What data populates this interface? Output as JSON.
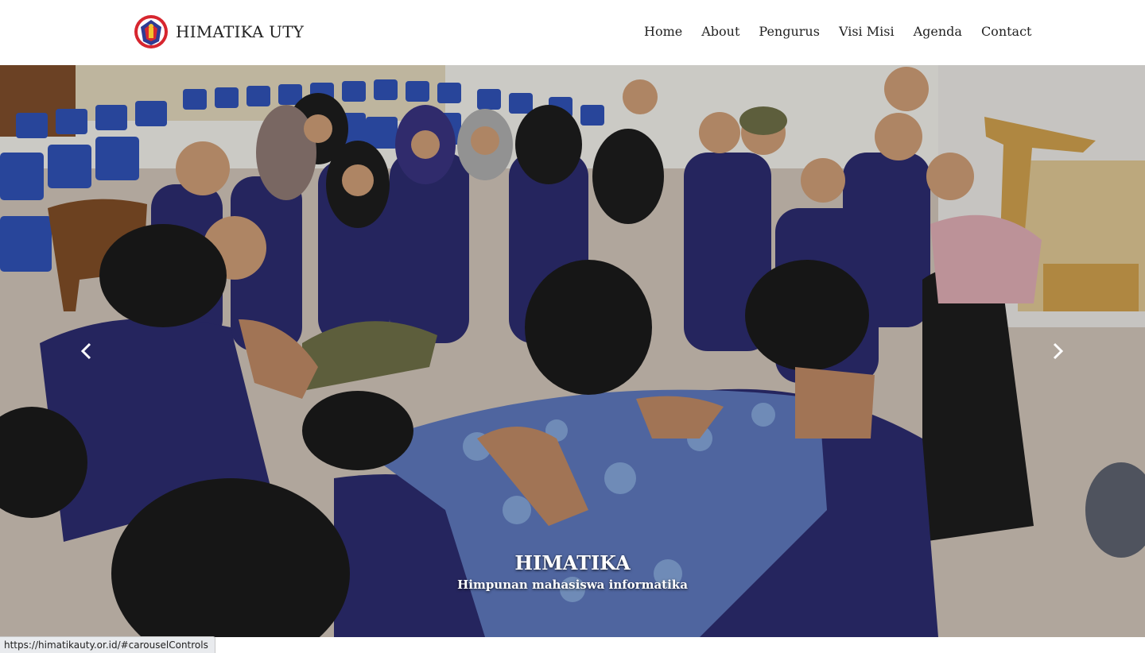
{
  "brand": {
    "name": "HIMATIKA UTY",
    "logo_icon": "himatika-emblem-icon"
  },
  "nav": {
    "items": [
      {
        "label": "Home"
      },
      {
        "label": "About"
      },
      {
        "label": "Pengurus"
      },
      {
        "label": "Visi Misi"
      },
      {
        "label": "Agenda"
      },
      {
        "label": "Contact"
      }
    ]
  },
  "carousel": {
    "caption_title": "HIMATIKA",
    "caption_subtitle": "Himpunan mahasiswa informatika",
    "prev_icon": "chevron-left-icon",
    "next_icon": "chevron-right-icon"
  },
  "status_url": "https://himatikauty.or.id/#carouselControls",
  "colors": {
    "navy": "#2b2b6b",
    "room_floor": "#c9bdb2",
    "chairs": "#2e4fb0"
  }
}
